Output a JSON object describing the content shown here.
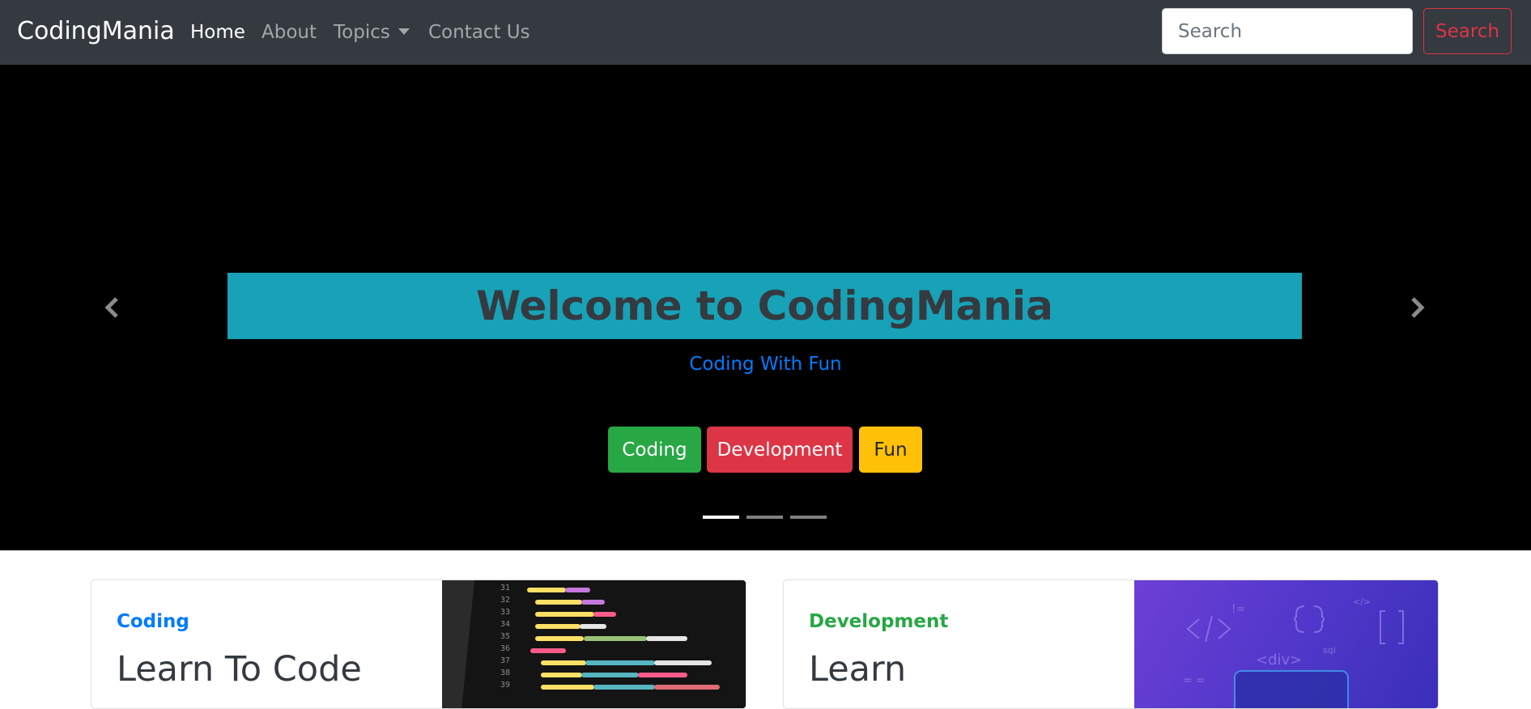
{
  "navbar": {
    "brand": "CodingMania",
    "links": [
      {
        "label": "Home",
        "active": true
      },
      {
        "label": "About"
      },
      {
        "label": "Topics",
        "dropdown": true
      },
      {
        "label": "Contact Us"
      }
    ],
    "search": {
      "placeholder": "Search",
      "button_label": "Search"
    }
  },
  "carousel": {
    "title": "Welcome to CodingMania",
    "subtitle": "Coding With Fun",
    "buttons": [
      {
        "label": "Coding",
        "color": "#28a745"
      },
      {
        "label": "Development",
        "color": "#dc3545"
      },
      {
        "label": "Fun",
        "color": "#ffc107"
      }
    ],
    "slide_count": 3,
    "active_slide": 1
  },
  "cards": [
    {
      "category": "Coding",
      "heading": "Learn To Code",
      "category_color": "#007bff",
      "image": "code-on-screen-image"
    },
    {
      "category": "Development",
      "heading": "Learn",
      "category_color": "#28a745",
      "image": "web-development-illustration"
    }
  ],
  "colors": {
    "navbar_bg": "#343a40",
    "hero_title_bg": "#17a2b8",
    "danger": "#dc3545",
    "primary": "#007bff"
  }
}
